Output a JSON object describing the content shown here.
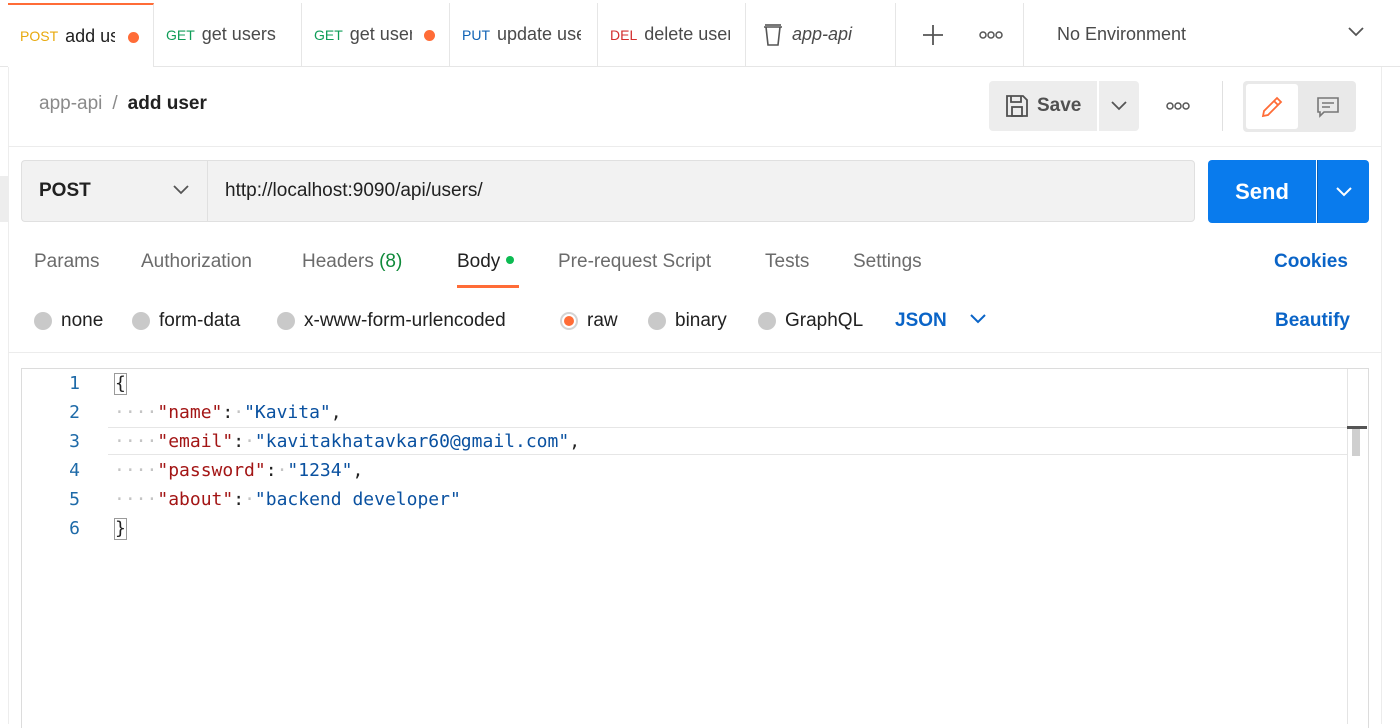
{
  "tabs": [
    {
      "method": "POST",
      "name": "add user",
      "unsaved": true,
      "active": true
    },
    {
      "method": "GET",
      "name": "get users",
      "unsaved": false
    },
    {
      "method": "GET",
      "name": "get user",
      "unsaved": true
    },
    {
      "method": "PUT",
      "name": "update user",
      "unsaved": false
    },
    {
      "method": "DEL",
      "name": "delete user",
      "unsaved": false
    }
  ],
  "collection_tab": "app-api",
  "environment": "No Environment",
  "breadcrumb": {
    "collection": "app-api",
    "separator": "/",
    "request": "add user"
  },
  "toolbar": {
    "save_label": "Save"
  },
  "request": {
    "method": "POST",
    "url": "http://localhost:9090/api/users/",
    "send_label": "Send"
  },
  "request_tabs": [
    {
      "label": "Params"
    },
    {
      "label": "Authorization"
    },
    {
      "label": "Headers",
      "count": "(8)"
    },
    {
      "label": "Body",
      "active": true
    },
    {
      "label": "Pre-request Script"
    },
    {
      "label": "Tests"
    },
    {
      "label": "Settings"
    }
  ],
  "cookies_label": "Cookies",
  "body_types": [
    "none",
    "form-data",
    "x-www-form-urlencoded",
    "raw",
    "binary",
    "GraphQL"
  ],
  "selected_body_type": "raw",
  "language": "JSON",
  "beautify_label": "Beautify",
  "editor": {
    "line_numbers": [
      "1",
      "2",
      "3",
      "4",
      "5",
      "6"
    ],
    "open_brace": "{",
    "close_brace": "}",
    "fields": [
      {
        "key": "\"name\"",
        "value": "\"Kavita\"",
        "comma": ","
      },
      {
        "key": "\"email\"",
        "value": "\"kavitakhatavkar60@gmail.com\"",
        "comma": ","
      },
      {
        "key": "\"password\"",
        "value": "\"1234\"",
        "comma": ","
      },
      {
        "key": "\"about\"",
        "value": "\"backend developer\"",
        "comma": ""
      }
    ]
  },
  "colors": {
    "accent": "#ff6c37",
    "primary": "#097bed",
    "link": "#0a64c7"
  }
}
